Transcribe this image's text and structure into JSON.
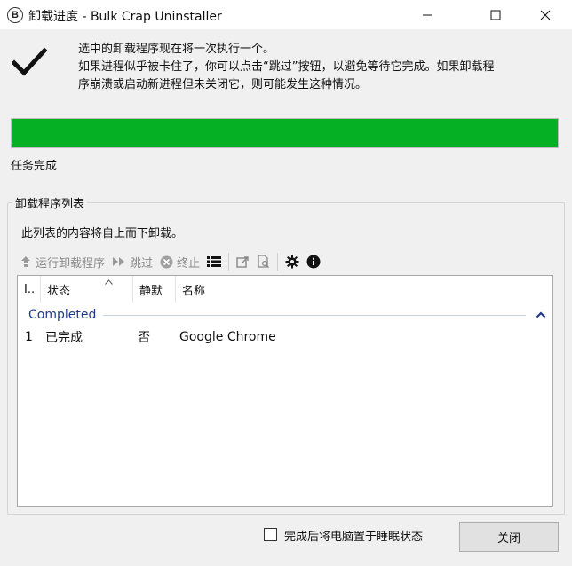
{
  "window": {
    "title": "卸载进度 - Bulk Crap Uninstaller",
    "app_icon_letter": "B"
  },
  "message": {
    "line1": "选中的卸载程序现在将一次执行一个。",
    "line2": "如果进程似乎被卡住了，你可以点击“跳过”按钮，以避免等待它完成。如果卸载程",
    "line3": "序崩溃或启动新进程但未关闭它，则可能发生这种情况。"
  },
  "progress": {
    "value_percent": 100,
    "status_text": "任务完成",
    "color": "#06b025"
  },
  "group": {
    "title": "卸载程序列表",
    "description": "此列表的内容将自上而下卸载。"
  },
  "toolbar": {
    "run_label": "运行卸载程序",
    "skip_label": "跳过",
    "terminate_label": "终止"
  },
  "list": {
    "columns": [
      "I..",
      "状态",
      "静默",
      "名称"
    ],
    "group_title": "Completed",
    "rows": [
      {
        "index": "1",
        "status": "已完成",
        "silent": "否",
        "name": "Google Chrome"
      }
    ]
  },
  "footer": {
    "sleep_label": "完成后将电脑置于睡眠状态",
    "sleep_checked": false,
    "close_label": "关闭"
  },
  "colors": {
    "accent_group": "#1e3a8a",
    "progress": "#06b025"
  }
}
